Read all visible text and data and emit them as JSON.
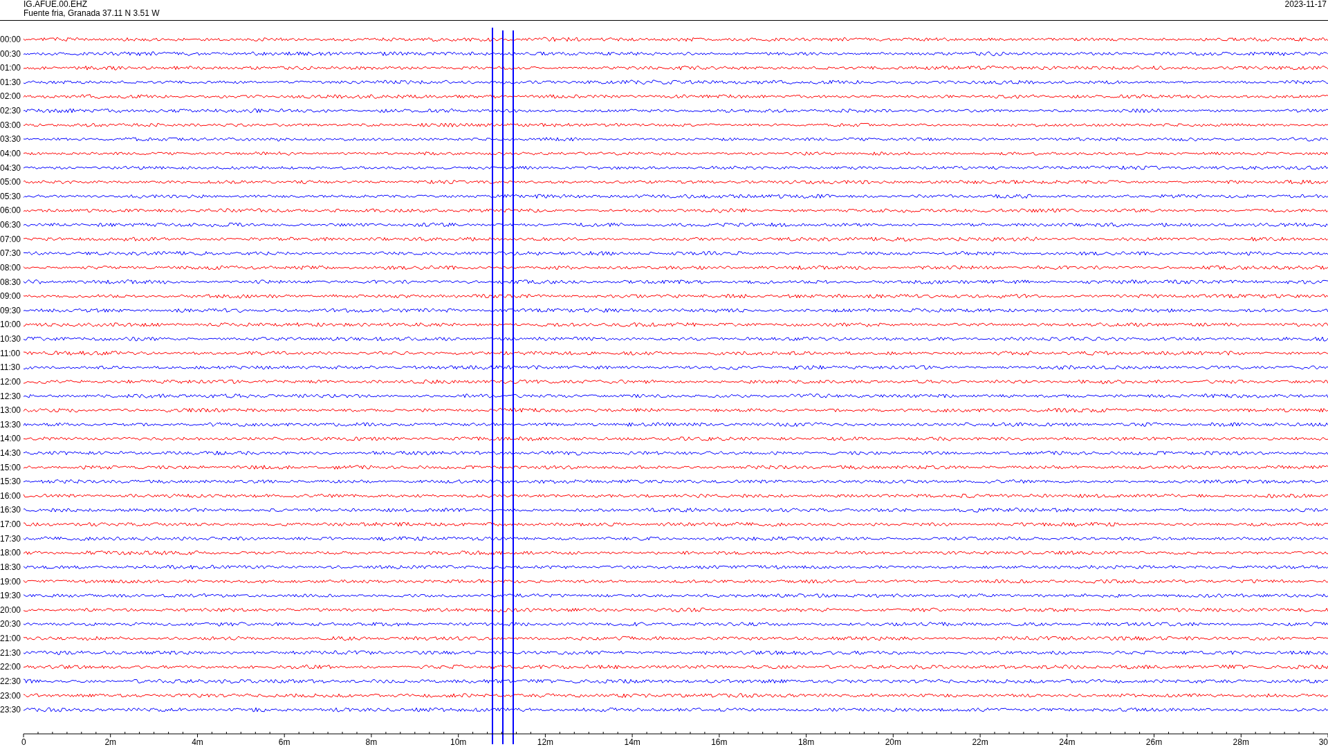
{
  "header": {
    "station": "IG.AFUE.00.EHZ",
    "location": "Fuente fria, Granada  37.11 N 3.51 W",
    "date": "2023-11-17"
  },
  "rows": [
    {
      "label": "00:00",
      "color": "#ff0000"
    },
    {
      "label": "00:30",
      "color": "#0000ff"
    },
    {
      "label": "01:00",
      "color": "#ff0000"
    },
    {
      "label": "01:30",
      "color": "#0000ff"
    },
    {
      "label": "02:00",
      "color": "#ff0000"
    },
    {
      "label": "02:30",
      "color": "#0000ff"
    },
    {
      "label": "03:00",
      "color": "#ff0000"
    },
    {
      "label": "03:30",
      "color": "#0000ff"
    },
    {
      "label": "04:00",
      "color": "#ff0000"
    },
    {
      "label": "04:30",
      "color": "#0000ff"
    },
    {
      "label": "05:00",
      "color": "#ff0000"
    },
    {
      "label": "05:30",
      "color": "#0000ff"
    },
    {
      "label": "06:00",
      "color": "#ff0000"
    },
    {
      "label": "06:30",
      "color": "#0000ff"
    },
    {
      "label": "07:00",
      "color": "#ff0000"
    },
    {
      "label": "07:30",
      "color": "#0000ff"
    },
    {
      "label": "08:00",
      "color": "#ff0000"
    },
    {
      "label": "08:30",
      "color": "#0000ff"
    },
    {
      "label": "09:00",
      "color": "#ff0000"
    },
    {
      "label": "09:30",
      "color": "#0000ff"
    },
    {
      "label": "10:00",
      "color": "#ff0000"
    },
    {
      "label": "10:30",
      "color": "#0000ff"
    },
    {
      "label": "11:00",
      "color": "#ff0000"
    },
    {
      "label": "11:30",
      "color": "#0000ff"
    },
    {
      "label": "12:00",
      "color": "#ff0000"
    },
    {
      "label": "12:30",
      "color": "#0000ff"
    },
    {
      "label": "13:00",
      "color": "#ff0000"
    },
    {
      "label": "13:30",
      "color": "#0000ff"
    },
    {
      "label": "14:00",
      "color": "#ff0000"
    },
    {
      "label": "14:30",
      "color": "#0000ff"
    },
    {
      "label": "15:00",
      "color": "#ff0000"
    },
    {
      "label": "15:30",
      "color": "#0000ff"
    },
    {
      "label": "16:00",
      "color": "#ff0000"
    },
    {
      "label": "16:30",
      "color": "#0000ff"
    },
    {
      "label": "17:00",
      "color": "#ff0000"
    },
    {
      "label": "17:30",
      "color": "#0000ff"
    },
    {
      "label": "18:00",
      "color": "#ff0000"
    },
    {
      "label": "18:30",
      "color": "#0000ff"
    },
    {
      "label": "19:00",
      "color": "#ff0000"
    },
    {
      "label": "19:30",
      "color": "#0000ff"
    },
    {
      "label": "20:00",
      "color": "#ff0000"
    },
    {
      "label": "20:30",
      "color": "#0000ff"
    },
    {
      "label": "21:00",
      "color": "#ff0000"
    },
    {
      "label": "21:30",
      "color": "#0000ff"
    },
    {
      "label": "22:00",
      "color": "#ff0000"
    },
    {
      "label": "22:30",
      "color": "#0000ff"
    },
    {
      "label": "23:00",
      "color": "#ff0000"
    },
    {
      "label": "23:30",
      "color": "#0000ff"
    }
  ],
  "x_axis": {
    "tick_labels": [
      "0",
      "2m",
      "4m",
      "6m",
      "8m",
      "10m",
      "12m",
      "14m",
      "16m",
      "18m",
      "20m",
      "22m",
      "24m",
      "26m",
      "28m",
      "30"
    ]
  }
}
